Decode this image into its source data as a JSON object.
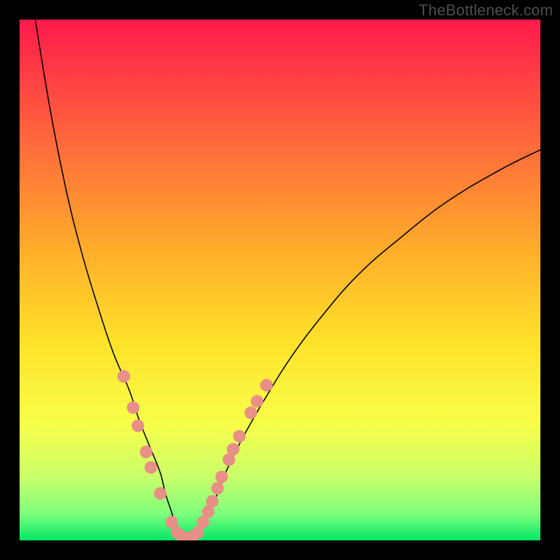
{
  "watermark": "TheBottleneck.com",
  "chart_data": {
    "type": "line",
    "title": "",
    "xlabel": "",
    "ylabel": "",
    "xlim": [
      0,
      100
    ],
    "ylim": [
      0,
      100
    ],
    "grid": false,
    "legend": false,
    "background_gradient": {
      "orientation": "vertical",
      "stops": [
        {
          "pos": 0.0,
          "color": "#ff1a4b"
        },
        {
          "pos": 0.25,
          "color": "#ff6e3a"
        },
        {
          "pos": 0.45,
          "color": "#ffb02a"
        },
        {
          "pos": 0.62,
          "color": "#ffe22a"
        },
        {
          "pos": 0.78,
          "color": "#f7ff4a"
        },
        {
          "pos": 0.88,
          "color": "#c8ff6a"
        },
        {
          "pos": 0.95,
          "color": "#7dff7d"
        },
        {
          "pos": 1.0,
          "color": "#00e765"
        }
      ]
    },
    "series": [
      {
        "name": "left-arm",
        "stroke": "#000000",
        "width": 1.6,
        "x": [
          3,
          6,
          9,
          12,
          15,
          18,
          21,
          23,
          25,
          27,
          28,
          29,
          30,
          31,
          32
        ],
        "y": [
          100,
          82,
          67,
          55,
          45,
          36,
          29,
          23,
          18,
          13,
          9,
          6,
          3,
          1,
          0
        ]
      },
      {
        "name": "right-arm",
        "stroke": "#000000",
        "width": 1.6,
        "x": [
          32,
          34,
          36,
          38,
          40,
          43,
          47,
          52,
          58,
          65,
          73,
          82,
          92,
          100
        ],
        "y": [
          0,
          2,
          5,
          9,
          14,
          20,
          27,
          35,
          43,
          51,
          58,
          65,
          71,
          75
        ]
      }
    ],
    "markers": {
      "name": "highlight-dots",
      "color": "#e88f87",
      "radius_px": 9,
      "points": [
        {
          "x": 20.0,
          "y": 31.5
        },
        {
          "x": 21.8,
          "y": 25.5
        },
        {
          "x": 22.7,
          "y": 22.0
        },
        {
          "x": 24.3,
          "y": 17.0
        },
        {
          "x": 25.2,
          "y": 14.0
        },
        {
          "x": 27.0,
          "y": 9.0
        },
        {
          "x": 29.2,
          "y": 3.5
        },
        {
          "x": 30.2,
          "y": 1.5
        },
        {
          "x": 31.2,
          "y": 0.7
        },
        {
          "x": 32.2,
          "y": 0.4
        },
        {
          "x": 33.2,
          "y": 0.7
        },
        {
          "x": 34.2,
          "y": 1.5
        },
        {
          "x": 35.2,
          "y": 3.5
        },
        {
          "x": 36.2,
          "y": 5.5
        },
        {
          "x": 37.0,
          "y": 7.5
        },
        {
          "x": 38.0,
          "y": 10.0
        },
        {
          "x": 38.8,
          "y": 12.2
        },
        {
          "x": 40.2,
          "y": 15.5
        },
        {
          "x": 41.0,
          "y": 17.5
        },
        {
          "x": 42.2,
          "y": 20.0
        },
        {
          "x": 44.4,
          "y": 24.5
        },
        {
          "x": 45.6,
          "y": 26.7
        },
        {
          "x": 47.4,
          "y": 29.8
        }
      ]
    }
  }
}
